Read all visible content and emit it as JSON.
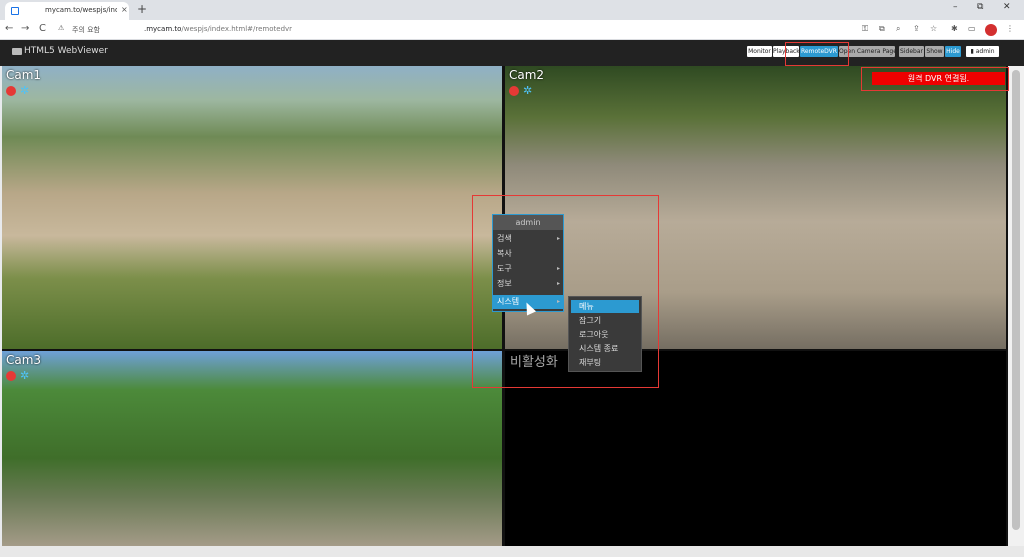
{
  "browser": {
    "tab_title": "mycam.to/wespjs/index",
    "tab_close": "×",
    "new_tab": "+",
    "window": {
      "minimize": "–",
      "restore": "⧉",
      "close": "✕"
    },
    "nav": {
      "back": "←",
      "forward": "→",
      "reload": "C"
    },
    "security_label": "주의 요함",
    "url_host": ".mycam.to",
    "url_path": "/wespjs/index.html#/remotedvr",
    "icons": {
      "key": "⚿",
      "translate": "⧉",
      "zoom": "⌕",
      "share": "⇪",
      "star": "☆",
      "extensions": "✱",
      "sidebar": "▭",
      "menu": "⋮"
    }
  },
  "app": {
    "title": "HTML5 WebViewer",
    "buttons": {
      "monitor": "Monitor",
      "playback": "Playback",
      "remote_dvr": "RemoteDVR",
      "open_camera_page": "Open Camera Page",
      "sidebar": "Sidebar",
      "show": "Show",
      "hide": "Hide",
      "user": "admin"
    }
  },
  "cameras": [
    {
      "label": "Cam1"
    },
    {
      "label": "Cam2"
    },
    {
      "label": "Cam3"
    }
  ],
  "alert": "원격 DVR 연결됨.",
  "disabled_text": "비활성화",
  "context_menu": {
    "header": "admin",
    "items": [
      "검색",
      "복사",
      "도구",
      "정보",
      "시스템"
    ],
    "submenu_arrow": "▸",
    "submenu": [
      "메뉴",
      "잠그기",
      "로그아웃",
      "시스템 종료",
      "재부팅"
    ]
  },
  "colors": {
    "accent": "#2c9ad1",
    "alert": "#ee0000",
    "header_bg": "#222222"
  }
}
